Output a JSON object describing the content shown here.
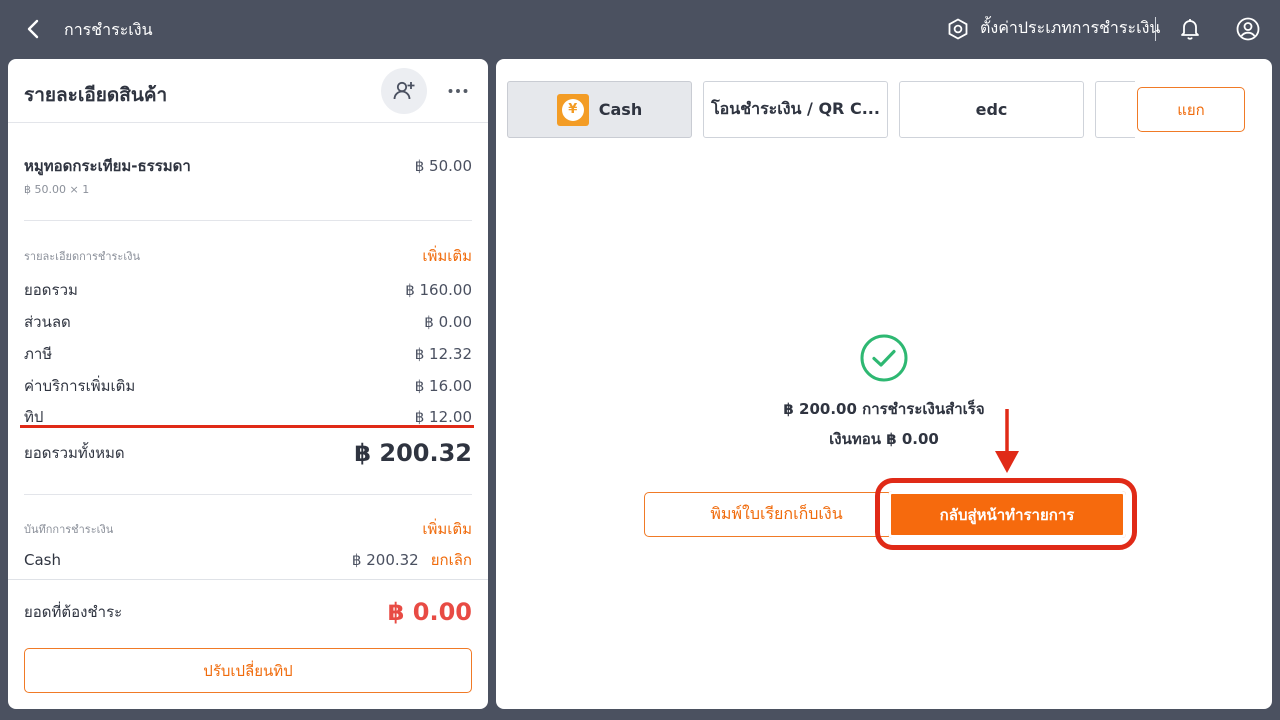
{
  "header": {
    "title": "การชำระเงิน",
    "settings_label": "ตั้งค่าประเภทการชำระเงิน"
  },
  "left": {
    "title": "รายละเอียดสินค้า",
    "item": {
      "name": "หมูทอดกระเทียม-ธรรมดา",
      "price": "฿ 50.00",
      "qty": "฿ 50.00 × 1"
    },
    "payment_details": {
      "label": "รายละเอียดการชำระเงิน",
      "more": "เพิ่มเติม",
      "rows": [
        {
          "label": "ยอดรวม",
          "value": "฿ 160.00"
        },
        {
          "label": "ส่วนลด",
          "value": "฿ 0.00"
        },
        {
          "label": "ภาษี",
          "value": "฿ 12.32"
        },
        {
          "label": "ค่าบริการเพิ่มเติม",
          "value": "฿ 16.00"
        },
        {
          "label": "ทิป",
          "value": "฿ 12.00"
        }
      ],
      "total_label": "ยอดรวมทั้งหมด",
      "total_value": "฿ 200.32"
    },
    "payment_record": {
      "label": "บันทึกการชำระเงิน",
      "more": "เพิ่มเติม",
      "method": "Cash",
      "amount": "฿ 200.32",
      "cancel": "ยกเลิก"
    },
    "due_label": "ยอดที่ต้องชำระ",
    "due_value": "฿ 0.00",
    "adjust_tip": "ปรับเปลี่ยนทิป"
  },
  "right": {
    "tabs": [
      "Cash",
      "โอนชำระเงิน / QR C...",
      "edc"
    ],
    "split": "แยก",
    "success": "฿ 200.00 การชำระเงินสำเร็จ",
    "change": "เงินทอน ฿ 0.00",
    "print": "พิมพ์ใบเรียกเก็บเงิน",
    "back_to_order": "กลับสู่หน้าทำรายการ"
  },
  "colors": {
    "accent": "#f66a0d",
    "highlight": "#e02a17",
    "success": "#2eb872",
    "due": "#e84b44"
  }
}
